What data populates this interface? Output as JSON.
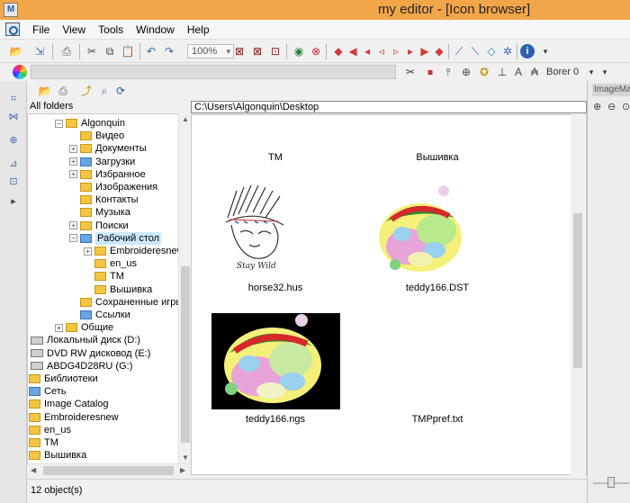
{
  "window": {
    "title": "my editor - [Icon browser]",
    "app_icon": "M"
  },
  "menu": [
    "File",
    "View",
    "Tools",
    "Window",
    "Help"
  ],
  "toolbar": {
    "zoom": "100%",
    "font": "Borer 0"
  },
  "tree": {
    "header": "All folders",
    "items": [
      {
        "label": "Algonquin",
        "indent": 1,
        "expander": "−",
        "icon": "user-folder"
      },
      {
        "label": "Видео",
        "indent": 2,
        "expander": "",
        "icon": "folder"
      },
      {
        "label": "Документы",
        "indent": 2,
        "expander": "+",
        "icon": "folder"
      },
      {
        "label": "Загрузки",
        "indent": 2,
        "expander": "+",
        "icon": "folder-blue"
      },
      {
        "label": "Избранное",
        "indent": 2,
        "expander": "+",
        "icon": "folder"
      },
      {
        "label": "Изображения",
        "indent": 2,
        "expander": "",
        "icon": "folder"
      },
      {
        "label": "Контакты",
        "indent": 2,
        "expander": "",
        "icon": "folder"
      },
      {
        "label": "Музыка",
        "indent": 2,
        "expander": "",
        "icon": "folder"
      },
      {
        "label": "Поиски",
        "indent": 2,
        "expander": "+",
        "icon": "folder"
      },
      {
        "label": "Рабочий стол",
        "indent": 2,
        "expander": "−",
        "icon": "folder-blue",
        "selected": true
      },
      {
        "label": "Embroideresnew",
        "indent": 3,
        "expander": "+",
        "icon": "folder"
      },
      {
        "label": "en_us",
        "indent": 3,
        "expander": "",
        "icon": "folder"
      },
      {
        "label": "TM",
        "indent": 3,
        "expander": "",
        "icon": "folder"
      },
      {
        "label": "Вышивка",
        "indent": 3,
        "expander": "",
        "icon": "folder"
      },
      {
        "label": "Сохраненные игры",
        "indent": 2,
        "expander": "",
        "icon": "folder"
      },
      {
        "label": "Ссылки",
        "indent": 2,
        "expander": "",
        "icon": "folder-blue"
      },
      {
        "label": "Общие",
        "indent": 1,
        "expander": "+",
        "icon": "folder"
      },
      {
        "label": "Локальный диск (D:)",
        "indent": 0,
        "expander": "",
        "icon": "drive"
      },
      {
        "label": "DVD RW дисковод (E:)",
        "indent": 0,
        "expander": "",
        "icon": "drive"
      },
      {
        "label": "ABDG4D28RU (G:)",
        "indent": 0,
        "expander": "",
        "icon": "drive"
      },
      {
        "label": "Библиотеки",
        "indent": -1,
        "expander": "",
        "icon": "folder"
      },
      {
        "label": "Сеть",
        "indent": -1,
        "expander": "",
        "icon": "folder-blue"
      },
      {
        "label": "Image Catalog",
        "indent": -1,
        "expander": "",
        "icon": "folder"
      },
      {
        "label": "Embroideresnew",
        "indent": -1,
        "expander": "",
        "icon": "folder"
      },
      {
        "label": "en_us",
        "indent": -1,
        "expander": "",
        "icon": "folder"
      },
      {
        "label": "TM",
        "indent": -1,
        "expander": "",
        "icon": "folder"
      },
      {
        "label": "Вышивка",
        "indent": -1,
        "expander": "",
        "icon": "folder"
      }
    ]
  },
  "path": "C:\\Users\\Algonquin\\Desktop",
  "files": [
    {
      "name": "TM",
      "kind": "folder"
    },
    {
      "name": "Вышивка",
      "kind": "folder"
    },
    {
      "name": "horse32.hus",
      "kind": "embroidery-line"
    },
    {
      "name": "teddy166.DST",
      "kind": "embroidery-color"
    },
    {
      "name": "teddy166.ngs",
      "kind": "embroidery-dark"
    },
    {
      "name": "TMPpref.txt",
      "kind": "text"
    }
  ],
  "right_panel": {
    "title": "ImageMa"
  },
  "status": "12 object(s)",
  "colors": {
    "titlebar": "#f2a64a",
    "selection": "#cce8ff"
  }
}
